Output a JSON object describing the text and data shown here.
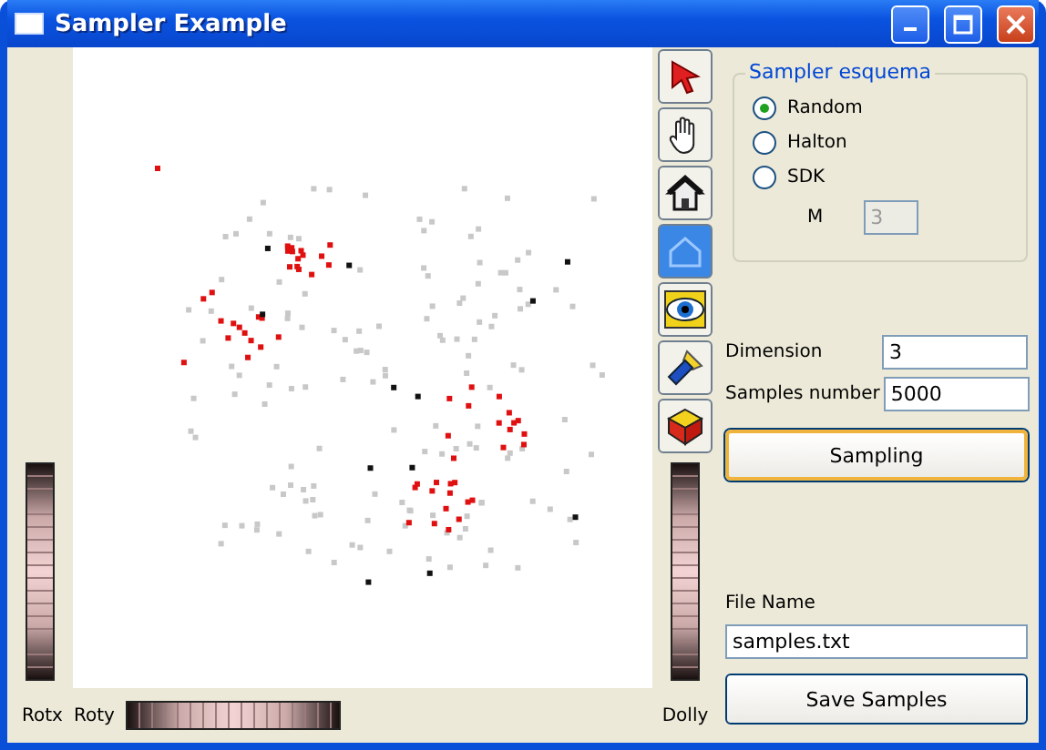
{
  "window": {
    "title": "Sampler Example"
  },
  "tools": [
    {
      "kind": "arrow",
      "selected": false
    },
    {
      "kind": "hand",
      "selected": false
    },
    {
      "kind": "home",
      "selected": false
    },
    {
      "kind": "view-all",
      "selected": true
    },
    {
      "kind": "eye",
      "selected": false
    },
    {
      "kind": "flashlight",
      "selected": false
    },
    {
      "kind": "cube",
      "selected": false
    }
  ],
  "sampler_group": {
    "title": "Sampler esquema",
    "options": [
      {
        "label": "Random",
        "selected": true
      },
      {
        "label": "Halton",
        "selected": false
      },
      {
        "label": "SDK",
        "selected": false
      }
    ],
    "m_label": "M",
    "m_value": "3",
    "m_disabled": true
  },
  "dimension": {
    "label": "Dimension",
    "value": "3"
  },
  "samples_number": {
    "label": "Samples number",
    "value": "5000"
  },
  "sampling_button": {
    "label": "Sampling",
    "default": true
  },
  "file_name": {
    "label": "File Name",
    "value": "samples.txt"
  },
  "save_button": {
    "label": "Save Samples",
    "default": false
  },
  "wheel_labels": {
    "rotx": "Rotx",
    "roty": "Roty",
    "dolly": "Dolly"
  }
}
